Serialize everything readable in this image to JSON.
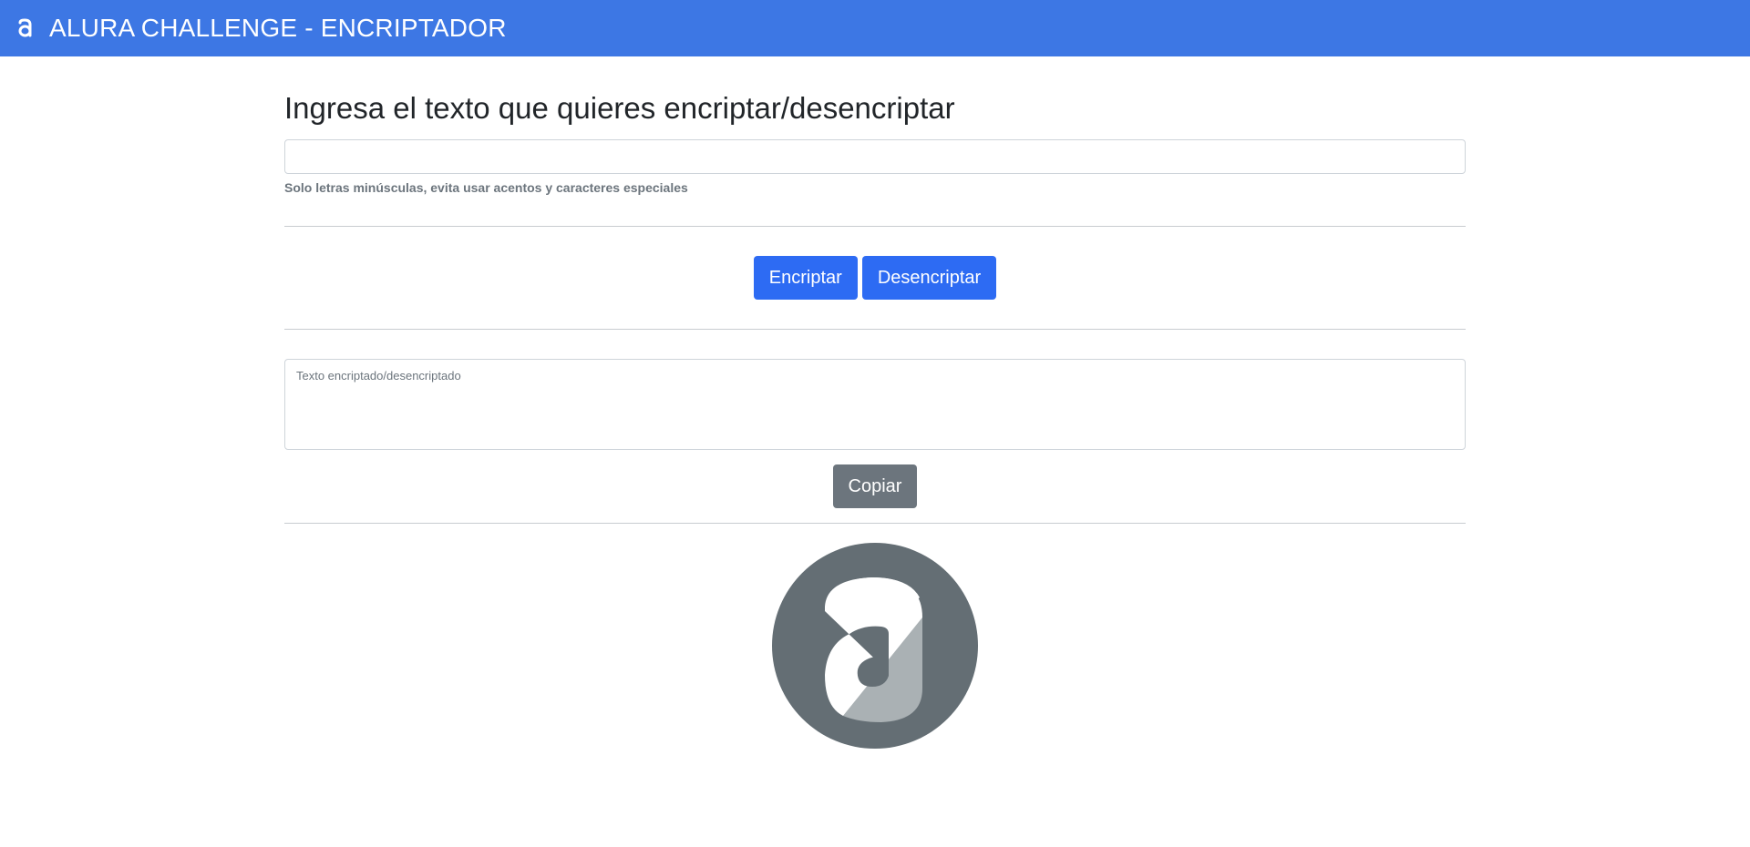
{
  "app": {
    "title": "ALURA CHALLENGE - ENCRIPTADOR",
    "logo_icon": "alura-a-logo-icon",
    "brand_color": "#3d77e4"
  },
  "main": {
    "heading": "Ingresa el texto que quieres encriptar/desencriptar",
    "input": {
      "value": "",
      "placeholder": ""
    },
    "help_text": "Solo letras minúsculas, evita usar acentos y caracteres especiales",
    "buttons": {
      "encrypt_label": "Encriptar",
      "decrypt_label": "Desencriptar",
      "primary_color": "#2d6bf3"
    },
    "output": {
      "value": "",
      "placeholder": "Texto encriptado/desencriptado"
    },
    "copy_label": "Copiar",
    "copy_color": "#6c757d",
    "footer_logo_icon": "alura-circle-logo-icon"
  }
}
